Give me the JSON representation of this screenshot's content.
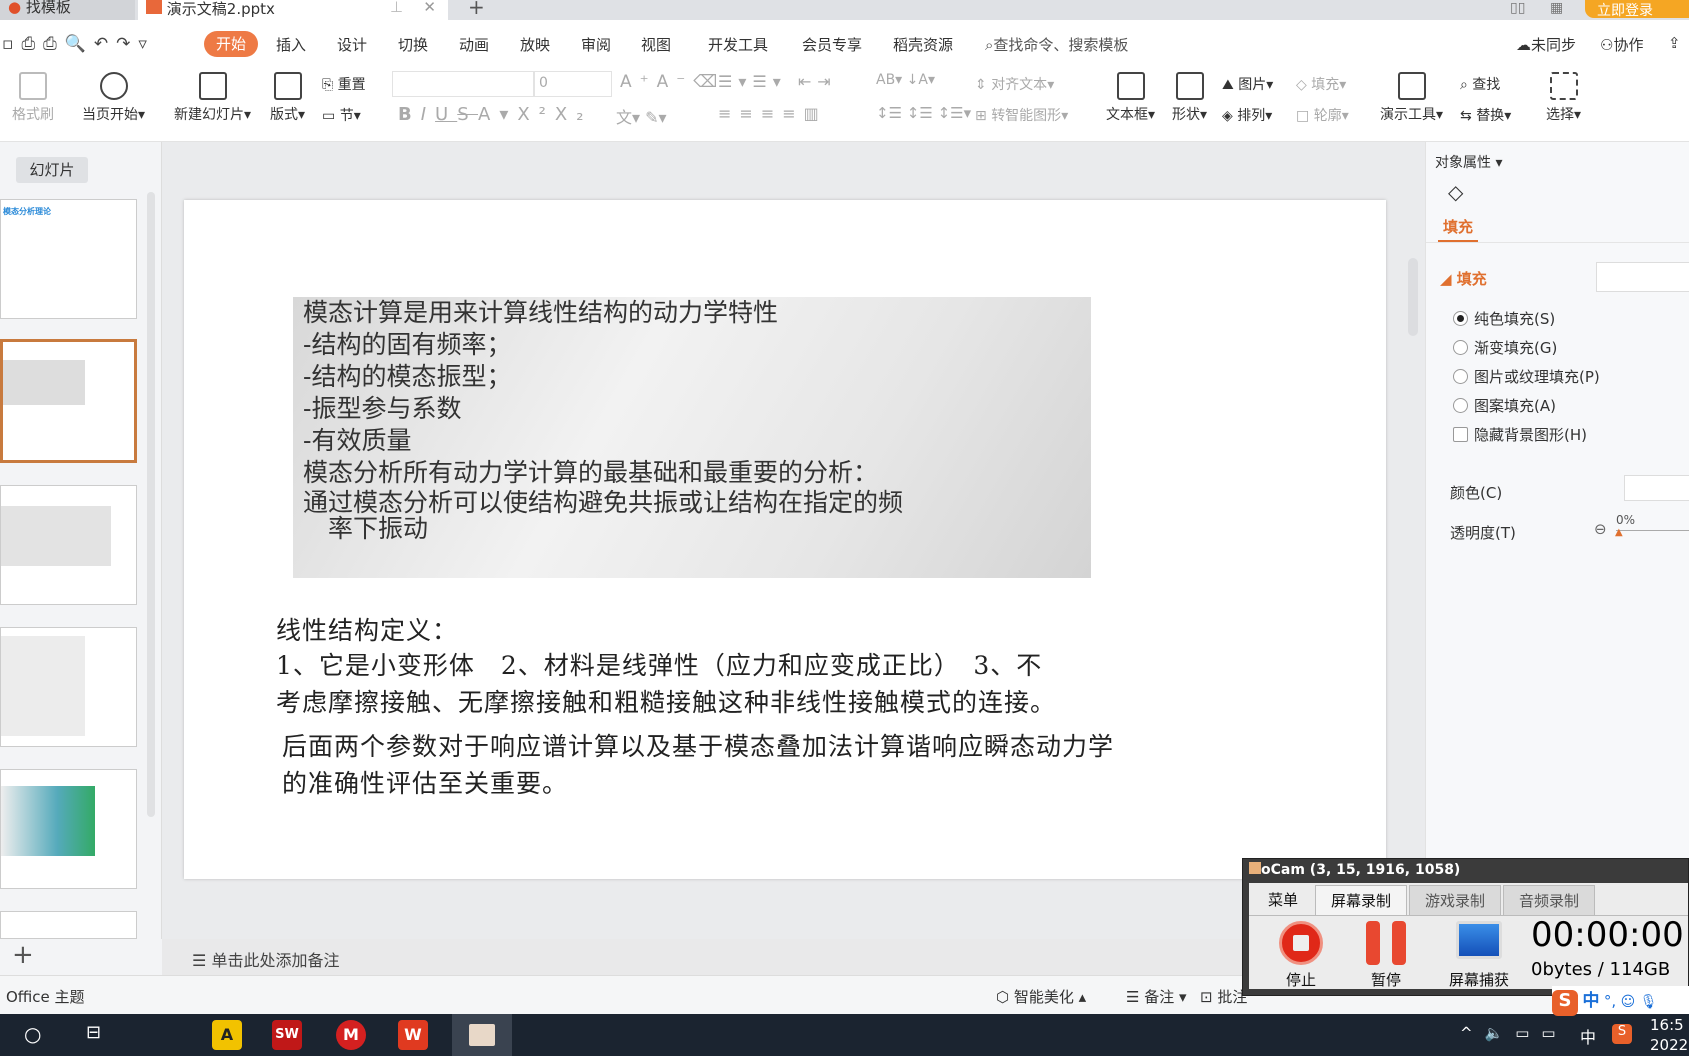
{
  "tabs": [
    {
      "label": "找模板"
    },
    {
      "label": "演示文稿2.pptx"
    }
  ],
  "titlebar": {
    "login": "立即登录"
  },
  "menu": {
    "quick": [
      "save",
      "print",
      "preview",
      "undo",
      "redo"
    ],
    "items": [
      "开始",
      "插入",
      "设计",
      "切换",
      "动画",
      "放映",
      "审阅",
      "视图",
      "开发工具",
      "会员专享",
      "稻壳资源"
    ],
    "active": "开始",
    "search": "查找命令、搜索模板",
    "sync": "未同步",
    "collab": "协作"
  },
  "ribbon": {
    "format_brush": "格式刷",
    "play_from": "当页开始",
    "new_slide": "新建幻灯片",
    "layout": "版式",
    "reset": "重置",
    "section": "节",
    "font_size": "0",
    "align_text": "对齐文本",
    "smart_art": "转智能图形",
    "textbox": "文本框",
    "shape": "形状",
    "picture": "图片",
    "fill": "填充",
    "arrange": "排列",
    "outline": "轮廓",
    "present_tools": "演示工具",
    "find": "查找",
    "replace": "替换",
    "select": "选择"
  },
  "left": {
    "tab": "幻灯片",
    "thumb1_title": "模态分析理论"
  },
  "slide": {
    "image_lines": [
      "模态计算是用来计算线性结构的动力学特性",
      "-结构的固有频率；",
      "-结构的模态振型；",
      "-振型参与系数",
      "-有效质量",
      "模态分析所有动力学计算的最基础和最重要的分析：",
      "通过模态分析可以使结构避免共振或让结构在指定的频",
      "　率下振动"
    ],
    "text_lines": [
      "线性结构定义：",
      "1、它是小变形体　2、材料是线弹性（应力和应变成正比）　3、不",
      "考虑摩擦接触、无摩擦接触和粗糙接触这种非线性接触模式的连接。",
      "后面两个参数对于响应谱计算以及基于模态叠加法计算谐响应瞬态动力学",
      "的准确性评估至关重要。"
    ]
  },
  "notes": {
    "placeholder": "单击此处添加备注"
  },
  "right": {
    "title": "对象属性",
    "tab": "填充",
    "section": "填充",
    "options": [
      "纯色填充(S)",
      "渐变填充(G)",
      "图片或纹理填充(P)",
      "图案填充(A)"
    ],
    "selected": 0,
    "hide_bg": "隐藏背景图形(H)",
    "color": "颜色(C)",
    "transparency": "透明度(T)",
    "transparency_value": "0%",
    "accent": "#e0702f"
  },
  "status": {
    "theme": "Office 主题",
    "beautify": "智能美化",
    "notes": "备注",
    "comment": "批注"
  },
  "ocam": {
    "title": "oCam (3, 15, 1916, 1058)",
    "tabs": [
      "菜单",
      "屏幕录制",
      "游戏录制",
      "音频录制"
    ],
    "active_tab": 1,
    "stop": "停止",
    "pause": "暂停",
    "capture": "屏幕捕获",
    "time": "00:00:00",
    "size": "0bytes / 114GB"
  },
  "ime": {
    "lang": "中",
    "punct": "°,"
  },
  "taskbar": {
    "apps": [
      "A",
      "SW",
      "M",
      "W",
      "oCam"
    ],
    "tray_lang": "中",
    "time": "16:5",
    "date": "2022"
  }
}
